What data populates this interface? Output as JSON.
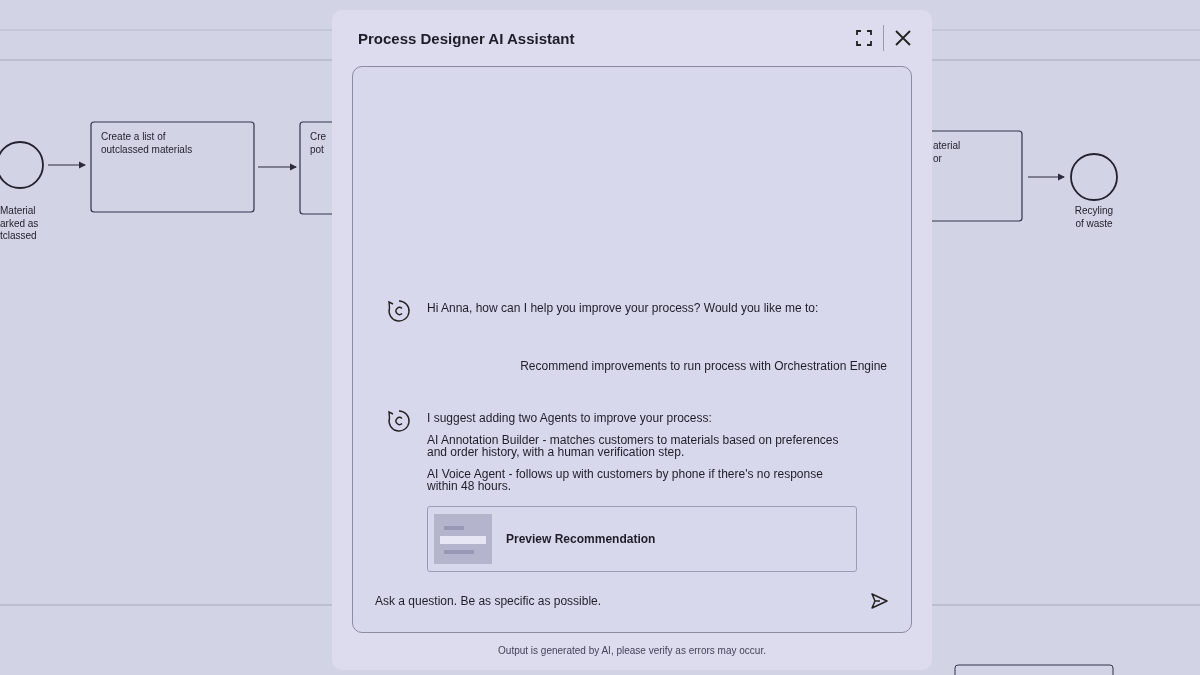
{
  "diagram": {
    "nodes": [
      {
        "kind": "event",
        "label": [
          "Material",
          "arked as",
          "tclassed"
        ]
      },
      {
        "kind": "task",
        "label": [
          "Create a list of",
          "outclassed materials"
        ]
      },
      {
        "kind": "task",
        "label": [
          "Cre",
          "pot"
        ]
      },
      {
        "kind": "task",
        "label": [
          "aterial",
          "or"
        ]
      },
      {
        "kind": "event",
        "label": [
          "Recyling",
          "of waste"
        ]
      }
    ]
  },
  "dialog": {
    "title": "Process Designer AI Assistant",
    "messages": [
      {
        "kind": "assistant",
        "paragraphs": [
          "Hi Anna, how can I help you improve your process? Would you like me to:"
        ]
      },
      {
        "kind": "user",
        "text": "Recommend improvements to run process with Orchestration Engine"
      },
      {
        "kind": "assistant",
        "paragraphs": [
          "I suggest adding two Agents to improve your process:",
          "AI Annotation Builder - matches customers to materials based on preferences and order history, with a human verification step.",
          "AI Voice Agent - follows up with customers by phone if there's no response within 48 hours."
        ],
        "card": {
          "label": "Preview Recommendation"
        }
      }
    ],
    "input": {
      "placeholder": "Ask a question. Be as specific as possible."
    },
    "disclaimer": "Output is generated by AI, please verify as errors may occur."
  }
}
